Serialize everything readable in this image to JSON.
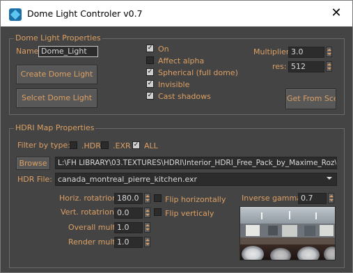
{
  "window": {
    "title": "Dome Light Controler v0.7",
    "close_glyph": "✕"
  },
  "dome_light_properties": {
    "group_title": "Dome Light Properties",
    "name_label": "Name:",
    "name_value": "Dome_Light",
    "create_button": "Create Dome Light",
    "select_button": "Selcet Dome Light",
    "checkboxes": [
      {
        "label": "On",
        "checked": true
      },
      {
        "label": "Affect alpha",
        "checked": false
      },
      {
        "label": "Spherical (full dome)",
        "checked": true
      },
      {
        "label": "Invisible",
        "checked": true
      },
      {
        "label": "Cast shadows",
        "checked": true
      }
    ],
    "multiplier_label": "Multiplier:",
    "multiplier_value": "3.0",
    "res_label": "res:",
    "res_value": "512",
    "get_from_scene_button": "Get From Scene"
  },
  "hdri_map_properties": {
    "group_title": "HDRI Map Properties",
    "filter_label": "Filter by type:",
    "filters": [
      {
        "label": ".HDR",
        "checked": false
      },
      {
        "label": ".EXR",
        "checked": false
      },
      {
        "label": "ALL",
        "checked": true
      }
    ],
    "browse_button": "Browse",
    "path_value": "L:\\FH LIBRARY\\03.TEXTURES\\HDRI\\Interior_HDRI_Free_Pack_by_Maxime_Roz\\",
    "hdr_file_label": "HDR File:",
    "hdr_file_value": "canada_montreal_pierre_kitchen.exr",
    "horiz_rotation_label": "Horiz. rotatrion:",
    "horiz_rotation_value": "180.0",
    "vert_rotation_label": "Vert. rotatrion:",
    "vert_rotation_value": "0.0",
    "overall_mult_label": "Overall mult:",
    "overall_mult_value": "1.0",
    "render_mult_label": "Render mult:",
    "render_mult_value": "1.0",
    "flip_horizontally_label": "Flip horizontally",
    "flip_horizontally_checked": false,
    "flip_vertically_label": "Flip verticaly",
    "flip_vertically_checked": false,
    "inverse_gamma_label": "Inverse gamma:",
    "inverse_gamma_value": "0.7"
  },
  "colors": {
    "background": "#444444",
    "label_orange": "#dda064",
    "field_dark": "#2c2c2c",
    "field_text": "#dadada"
  }
}
